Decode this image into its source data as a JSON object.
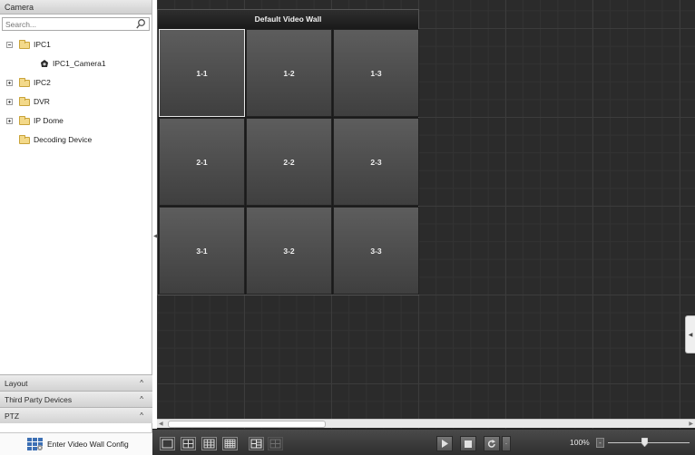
{
  "left_panel": {
    "title": "Camera",
    "search": {
      "placeholder": "Search...",
      "value": ""
    },
    "tree": [
      {
        "label": "IPC1",
        "expanded": true,
        "children": [
          {
            "label": "IPC1_Camera1"
          }
        ]
      },
      {
        "label": "IPC2",
        "expanded": false
      },
      {
        "label": "DVR",
        "expanded": false
      },
      {
        "label": "IP Dome",
        "expanded": false
      },
      {
        "label": "Decoding Device"
      }
    ],
    "sections": [
      {
        "label": "Layout"
      },
      {
        "label": "Third Party Devices"
      },
      {
        "label": "PTZ"
      }
    ],
    "enter_config_label": "Enter Video Wall Config"
  },
  "video_wall": {
    "title": "Default Video Wall",
    "screens": [
      [
        "1-1",
        "1-2",
        "1-3"
      ],
      [
        "2-1",
        "2-2",
        "2-3"
      ],
      [
        "3-1",
        "3-2",
        "3-3"
      ]
    ],
    "selected_screen": "1-1"
  },
  "toolbar": {
    "zoom_label": "100%",
    "zoom_minus": "-",
    "zoom_level": 0.45
  },
  "icons": {
    "search": "search-icon",
    "folder": "folder-icon",
    "camera": "camera-icon",
    "video_wall_config": "video-wall-config-icon",
    "play": "play-icon",
    "stop": "stop-icon",
    "refresh": "refresh-icon"
  },
  "colors": {
    "canvas_background": "#2b2b2b",
    "screen": "#4d4d4d",
    "toolbar": "#3a3a3a"
  }
}
